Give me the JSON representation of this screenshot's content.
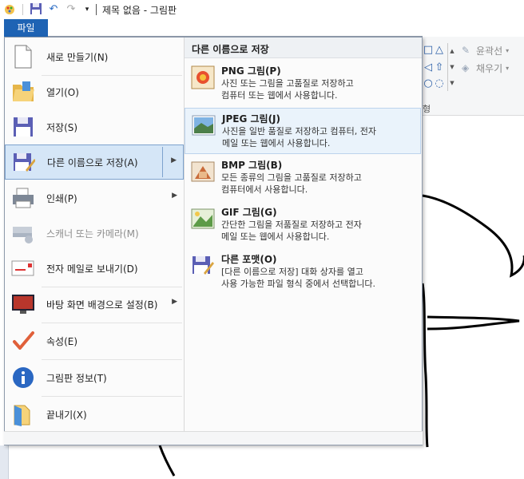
{
  "window": {
    "title": "제목 없음 - 그림판"
  },
  "quick_access": {
    "icons": [
      "paint-app-icon",
      "save-icon",
      "undo-icon",
      "redo-icon",
      "customize-dropdown-icon"
    ]
  },
  "file_tab": {
    "label": "파일"
  },
  "file_menu": {
    "items": [
      {
        "label": "새로 만들기(N)",
        "icon": "new-document-icon",
        "enabled": true,
        "submenu": false
      },
      {
        "label": "열기(O)",
        "icon": "open-folder-icon",
        "enabled": true,
        "submenu": false
      },
      {
        "label": "저장(S)",
        "icon": "save-icon",
        "enabled": true,
        "submenu": false
      },
      {
        "label": "다른 이름으로 저장(A)",
        "icon": "save-as-icon",
        "enabled": true,
        "submenu": true,
        "active": true
      },
      {
        "label": "인쇄(P)",
        "icon": "printer-icon",
        "enabled": true,
        "submenu": true
      },
      {
        "label": "스캐너 또는 카메라(M)",
        "icon": "scanner-icon",
        "enabled": false,
        "submenu": false
      },
      {
        "label": "전자 메일로 보내기(D)",
        "icon": "email-icon",
        "enabled": true,
        "submenu": false
      },
      {
        "label": "바탕 화면 배경으로 설정(B)",
        "icon": "desktop-background-icon",
        "enabled": true,
        "submenu": true
      },
      {
        "label": "속성(E)",
        "icon": "properties-checkmark-icon",
        "enabled": true,
        "submenu": false
      },
      {
        "label": "그림판 정보(T)",
        "icon": "info-icon",
        "enabled": true,
        "submenu": false
      },
      {
        "label": "끝내기(X)",
        "icon": "exit-icon",
        "enabled": true,
        "submenu": false
      }
    ]
  },
  "save_as_submenu": {
    "title": "다른 이름으로 저장",
    "options": [
      {
        "title": "PNG 그림(P)",
        "desc_line1": "사진 또는 그림을 고품질로 저장하고",
        "desc_line2": "컴퓨터 또는 웹에서 사용합니다.",
        "icon": "png-image-icon"
      },
      {
        "title": "JPEG 그림(J)",
        "desc_line1": "사진을 일반 품질로 저장하고 컴퓨터, 전자",
        "desc_line2": "메일 또는 웹에서 사용합니다.",
        "icon": "jpeg-image-icon",
        "active": true
      },
      {
        "title": "BMP 그림(B)",
        "desc_line1": "모든 종류의 그림을 고품질로 저장하고",
        "desc_line2": "컴퓨터에서 사용합니다.",
        "icon": "bmp-image-icon"
      },
      {
        "title": "GIF 그림(G)",
        "desc_line1": "간단한 그림을 저품질로 저장하고 전자",
        "desc_line2": "메일 또는 웹에서 사용합니다.",
        "icon": "gif-image-icon"
      },
      {
        "title": "다른 포맷(O)",
        "desc_line1": "[다른 이름으로 저장] 대화 상자를 열고",
        "desc_line2": "사용 가능한 파일 형식 중에서 선택합니다.",
        "icon": "other-formats-icon"
      }
    ]
  },
  "ribbon": {
    "outline_label": "윤곽선",
    "fill_label": "채우기",
    "group_label": "형"
  },
  "colors": {
    "file_tab": "#1e63b4",
    "active_item": "#d5e6f7",
    "active_border": "#7da2ce"
  }
}
